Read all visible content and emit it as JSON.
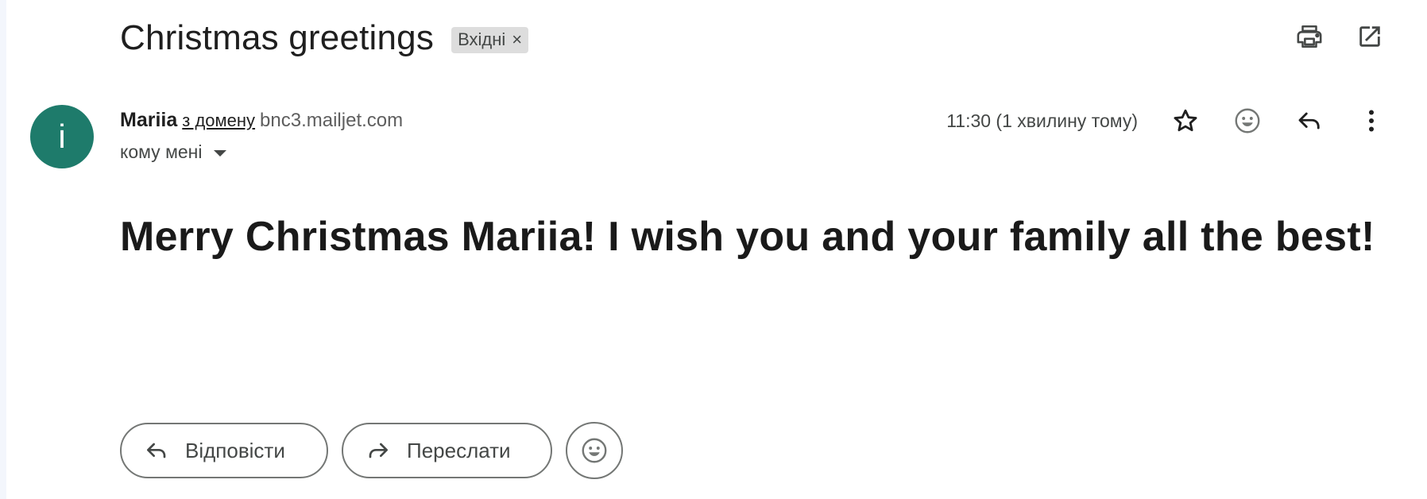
{
  "email": {
    "subject": "Christmas greetings",
    "label": "Вхідні",
    "label_remove": "×",
    "sender": {
      "avatar_letter": "i",
      "avatar_color": "#1e7b6b",
      "name": "Mariia",
      "via_text": "з домену",
      "domain": "bnc3.mailjet.com",
      "to_text": "кому мені"
    },
    "timestamp": "11:30 (1 хвилину тому)",
    "body": "Merry Christmas Mariia! I wish you and your family all the best!"
  },
  "toolbar": {
    "print_icon": "print-icon",
    "open_new_window_icon": "open-in-new-window-icon"
  },
  "message_actions": {
    "star_icon": "star-icon",
    "emoji_icon": "emoji-icon",
    "reply_icon": "reply-icon",
    "more_icon": "more-vert-icon"
  },
  "bottom_actions": {
    "reply_label": "Відповісти",
    "forward_label": "Переслати"
  },
  "colors": {
    "avatar": "#1e7b6b",
    "chip_bg": "#dddddd",
    "text": "#1f1f1f",
    "secondary_text": "#444746"
  }
}
